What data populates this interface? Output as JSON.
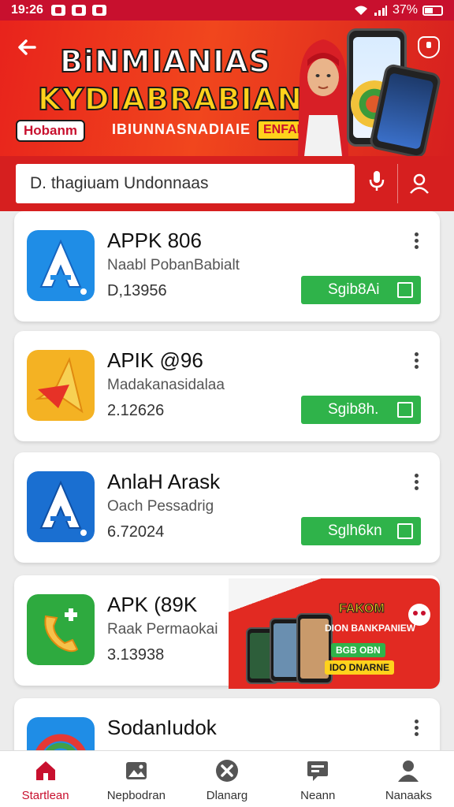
{
  "status_bar": {
    "time": "19:26",
    "battery": "37%"
  },
  "banner": {
    "title_line1": "BiNMIANIAS",
    "title_line2": "KYDIABRABIAN",
    "tag_left": "Hobanm",
    "subtitle": "IBIUNNASNADIAIE",
    "tag_right": "ENFANILS"
  },
  "search": {
    "value": "D. thagiuam Undonnaas"
  },
  "apps": [
    {
      "name": "APPK 806",
      "developer": "Naabl PobanBabialt",
      "downloads": "D,13956",
      "button": "Sgib8Ai"
    },
    {
      "name": "APIK @96",
      "developer": "Madakanasidalaa",
      "downloads": "2.12626",
      "button": "Sgib8h."
    },
    {
      "name": "AnlaH Arask",
      "developer": "Oach Pessadrig",
      "downloads": "6.72024",
      "button": "Sglh6kn"
    },
    {
      "name": "APK (89K",
      "developer": "Raak Permaokai",
      "downloads": "3.13938"
    },
    {
      "name": "SodanIudok"
    }
  ],
  "promo": {
    "title": "FAKOM",
    "line": "DION BANKPANIEW",
    "box1": "BGB OBN",
    "box2": "IDO DNARNE"
  },
  "bottom_nav": [
    {
      "label": "Startlean",
      "icon": "home-icon"
    },
    {
      "label": "Nepbodran",
      "icon": "image-icon"
    },
    {
      "label": "Dlanarg",
      "icon": "close-circle-icon"
    },
    {
      "label": "Neann",
      "icon": "message-icon"
    },
    {
      "label": "Nanaaks",
      "icon": "person-icon"
    }
  ],
  "colors": {
    "brand_red": "#c8102e",
    "button_green": "#2fb34a"
  }
}
